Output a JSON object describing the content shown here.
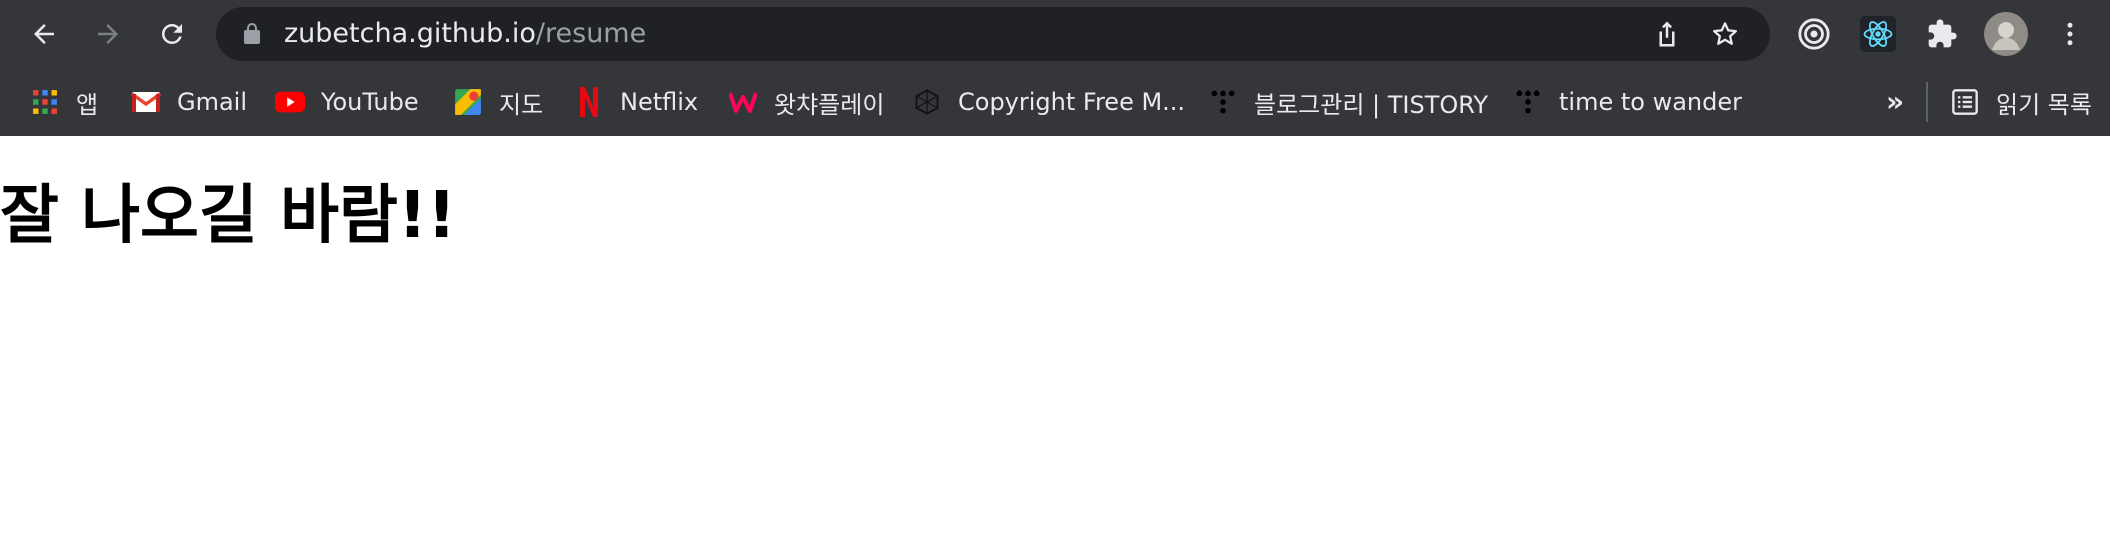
{
  "browser": {
    "url_host": "zubetcha.github.io",
    "url_path": "/resume",
    "icons": {
      "back": "arrow-left-icon",
      "forward": "arrow-right-icon",
      "reload": "reload-icon",
      "lock": "lock-icon",
      "share": "share-icon",
      "bookmark": "star-icon",
      "extension_target": "target-icon",
      "extension_react": "react-icon",
      "extensions": "puzzle-icon",
      "profile": "avatar",
      "menu": "kebab-menu-icon"
    }
  },
  "bookmarks": {
    "items": [
      {
        "label": "앱",
        "icon": "apps-grid-icon"
      },
      {
        "label": "Gmail",
        "icon": "gmail-icon"
      },
      {
        "label": "YouTube",
        "icon": "youtube-icon"
      },
      {
        "label": "지도",
        "icon": "maps-icon"
      },
      {
        "label": "Netflix",
        "icon": "netflix-icon"
      },
      {
        "label": "왓챠플레이",
        "icon": "watcha-icon"
      },
      {
        "label": "Copyright Free M...",
        "icon": "copyright-free-icon"
      },
      {
        "label": "블로그관리 | TISTORY",
        "icon": "tistory-icon"
      },
      {
        "label": "time to wander",
        "icon": "tistory-icon"
      }
    ],
    "overflow_label": "»",
    "reading_list_label": "읽기 목록"
  },
  "page": {
    "heading": "잘 나오길 바람!!"
  },
  "colors": {
    "chrome_bg": "#35363a",
    "omnibox_bg": "#202124",
    "text_light": "#e8eaed",
    "text_dim": "#9aa0a6",
    "youtube_red": "#ff0000",
    "netflix_red": "#e50914",
    "watcha_pink": "#ff0558",
    "react_blue": "#61dafb"
  }
}
